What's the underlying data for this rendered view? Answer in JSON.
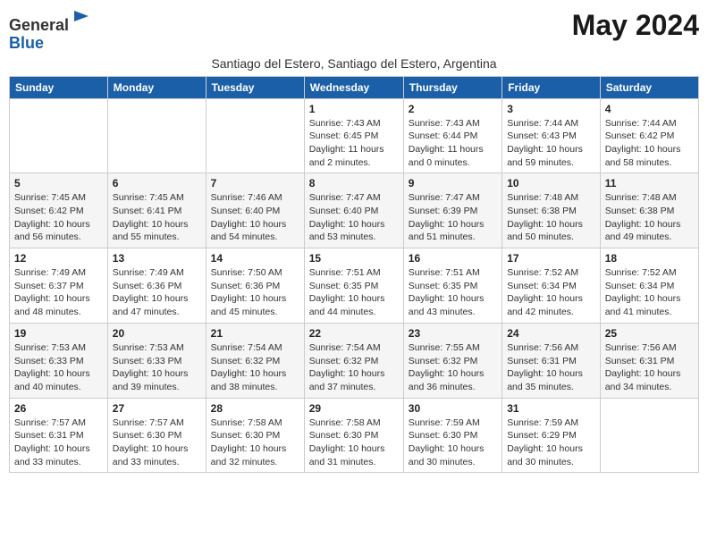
{
  "header": {
    "logo_line1": "General",
    "logo_line2": "Blue",
    "month_title": "May 2024",
    "subtitle": "Santiago del Estero, Santiago del Estero, Argentina"
  },
  "days_of_week": [
    "Sunday",
    "Monday",
    "Tuesday",
    "Wednesday",
    "Thursday",
    "Friday",
    "Saturday"
  ],
  "weeks": [
    [
      {
        "day": "",
        "info": ""
      },
      {
        "day": "",
        "info": ""
      },
      {
        "day": "",
        "info": ""
      },
      {
        "day": "1",
        "info": "Sunrise: 7:43 AM\nSunset: 6:45 PM\nDaylight: 11 hours and 2 minutes."
      },
      {
        "day": "2",
        "info": "Sunrise: 7:43 AM\nSunset: 6:44 PM\nDaylight: 11 hours and 0 minutes."
      },
      {
        "day": "3",
        "info": "Sunrise: 7:44 AM\nSunset: 6:43 PM\nDaylight: 10 hours and 59 minutes."
      },
      {
        "day": "4",
        "info": "Sunrise: 7:44 AM\nSunset: 6:42 PM\nDaylight: 10 hours and 58 minutes."
      }
    ],
    [
      {
        "day": "5",
        "info": "Sunrise: 7:45 AM\nSunset: 6:42 PM\nDaylight: 10 hours and 56 minutes."
      },
      {
        "day": "6",
        "info": "Sunrise: 7:45 AM\nSunset: 6:41 PM\nDaylight: 10 hours and 55 minutes."
      },
      {
        "day": "7",
        "info": "Sunrise: 7:46 AM\nSunset: 6:40 PM\nDaylight: 10 hours and 54 minutes."
      },
      {
        "day": "8",
        "info": "Sunrise: 7:47 AM\nSunset: 6:40 PM\nDaylight: 10 hours and 53 minutes."
      },
      {
        "day": "9",
        "info": "Sunrise: 7:47 AM\nSunset: 6:39 PM\nDaylight: 10 hours and 51 minutes."
      },
      {
        "day": "10",
        "info": "Sunrise: 7:48 AM\nSunset: 6:38 PM\nDaylight: 10 hours and 50 minutes."
      },
      {
        "day": "11",
        "info": "Sunrise: 7:48 AM\nSunset: 6:38 PM\nDaylight: 10 hours and 49 minutes."
      }
    ],
    [
      {
        "day": "12",
        "info": "Sunrise: 7:49 AM\nSunset: 6:37 PM\nDaylight: 10 hours and 48 minutes."
      },
      {
        "day": "13",
        "info": "Sunrise: 7:49 AM\nSunset: 6:36 PM\nDaylight: 10 hours and 47 minutes."
      },
      {
        "day": "14",
        "info": "Sunrise: 7:50 AM\nSunset: 6:36 PM\nDaylight: 10 hours and 45 minutes."
      },
      {
        "day": "15",
        "info": "Sunrise: 7:51 AM\nSunset: 6:35 PM\nDaylight: 10 hours and 44 minutes."
      },
      {
        "day": "16",
        "info": "Sunrise: 7:51 AM\nSunset: 6:35 PM\nDaylight: 10 hours and 43 minutes."
      },
      {
        "day": "17",
        "info": "Sunrise: 7:52 AM\nSunset: 6:34 PM\nDaylight: 10 hours and 42 minutes."
      },
      {
        "day": "18",
        "info": "Sunrise: 7:52 AM\nSunset: 6:34 PM\nDaylight: 10 hours and 41 minutes."
      }
    ],
    [
      {
        "day": "19",
        "info": "Sunrise: 7:53 AM\nSunset: 6:33 PM\nDaylight: 10 hours and 40 minutes."
      },
      {
        "day": "20",
        "info": "Sunrise: 7:53 AM\nSunset: 6:33 PM\nDaylight: 10 hours and 39 minutes."
      },
      {
        "day": "21",
        "info": "Sunrise: 7:54 AM\nSunset: 6:32 PM\nDaylight: 10 hours and 38 minutes."
      },
      {
        "day": "22",
        "info": "Sunrise: 7:54 AM\nSunset: 6:32 PM\nDaylight: 10 hours and 37 minutes."
      },
      {
        "day": "23",
        "info": "Sunrise: 7:55 AM\nSunset: 6:32 PM\nDaylight: 10 hours and 36 minutes."
      },
      {
        "day": "24",
        "info": "Sunrise: 7:56 AM\nSunset: 6:31 PM\nDaylight: 10 hours and 35 minutes."
      },
      {
        "day": "25",
        "info": "Sunrise: 7:56 AM\nSunset: 6:31 PM\nDaylight: 10 hours and 34 minutes."
      }
    ],
    [
      {
        "day": "26",
        "info": "Sunrise: 7:57 AM\nSunset: 6:31 PM\nDaylight: 10 hours and 33 minutes."
      },
      {
        "day": "27",
        "info": "Sunrise: 7:57 AM\nSunset: 6:30 PM\nDaylight: 10 hours and 33 minutes."
      },
      {
        "day": "28",
        "info": "Sunrise: 7:58 AM\nSunset: 6:30 PM\nDaylight: 10 hours and 32 minutes."
      },
      {
        "day": "29",
        "info": "Sunrise: 7:58 AM\nSunset: 6:30 PM\nDaylight: 10 hours and 31 minutes."
      },
      {
        "day": "30",
        "info": "Sunrise: 7:59 AM\nSunset: 6:30 PM\nDaylight: 10 hours and 30 minutes."
      },
      {
        "day": "31",
        "info": "Sunrise: 7:59 AM\nSunset: 6:29 PM\nDaylight: 10 hours and 30 minutes."
      },
      {
        "day": "",
        "info": ""
      }
    ]
  ]
}
